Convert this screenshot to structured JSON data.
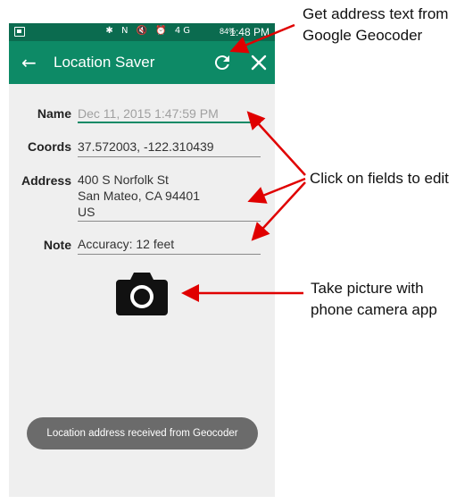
{
  "status_bar": {
    "icons": "✱ N 🔇 ⏰ 4G",
    "battery": "84%",
    "time": "1:48 PM"
  },
  "app_bar": {
    "title": "Location Saver",
    "back_icon": "back-arrow-icon",
    "refresh_icon": "refresh-icon",
    "close_icon": "close-icon"
  },
  "form": {
    "name_label": "Name",
    "name_placeholder": "Dec 11, 2015 1:47:59 PM",
    "coords_label": "Coords",
    "coords_value": "37.572003, -122.310439",
    "address_label": "Address",
    "address_line1": "400 S Norfolk St",
    "address_line2": "San Mateo, CA 94401",
    "address_line3": "US",
    "note_label": "Note",
    "note_value": "Accuracy: 12 feet"
  },
  "camera": {
    "icon": "camera-icon"
  },
  "toast": {
    "text": "Location address received from Geocoder"
  },
  "callouts": {
    "geocoder_line1": "Get address text from",
    "geocoder_line2": "Google Geocoder",
    "edit": "Click on fields to edit",
    "camera_line1": "Take picture with",
    "camera_line2": "phone camera app"
  },
  "colors": {
    "status_bar": "#0b6b4f",
    "app_bar": "#0d8a66",
    "screen_bg": "#efefef",
    "annotation_arrow": "#e00000"
  }
}
